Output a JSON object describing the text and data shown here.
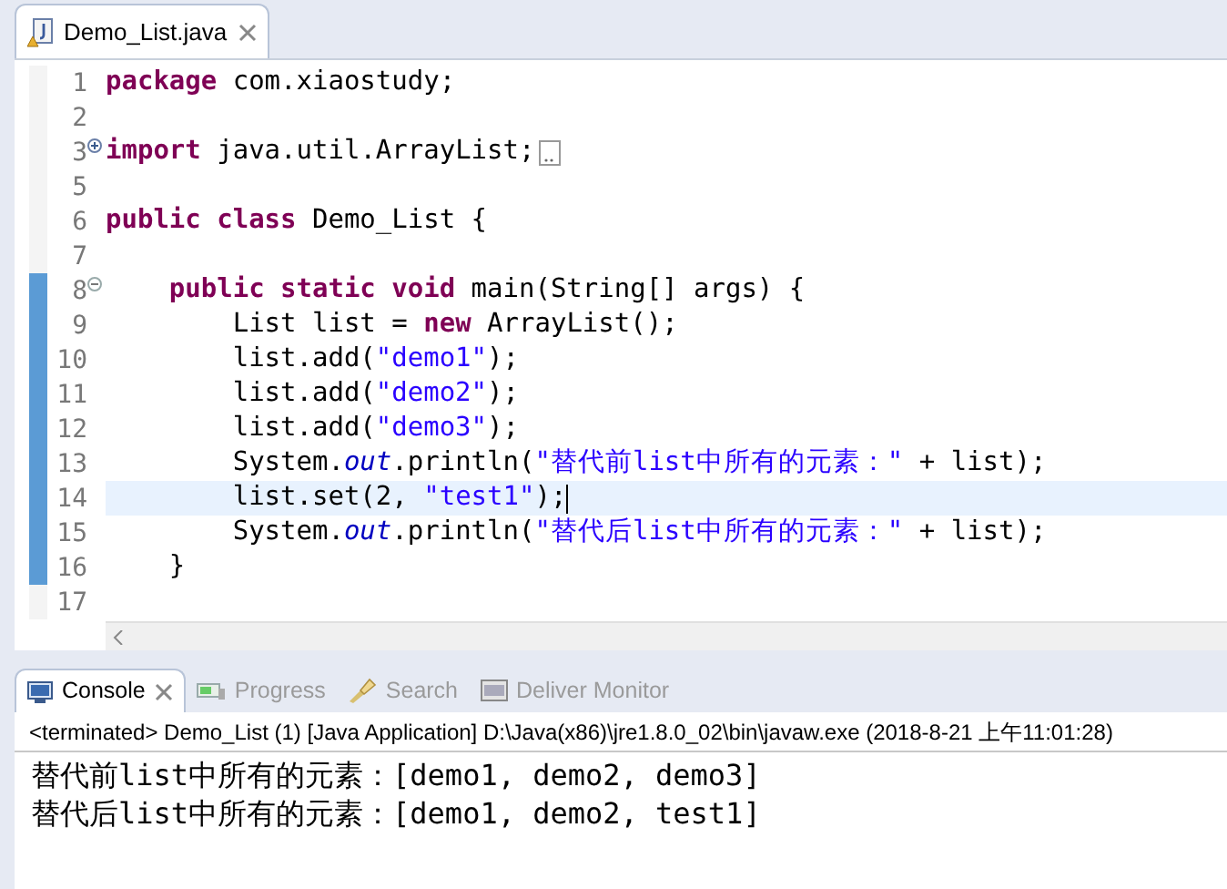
{
  "editor_tab": {
    "title": "Demo_List.java",
    "selected": true
  },
  "code_lines": [
    {
      "number": "1",
      "foldable": false,
      "changed": false,
      "current": false,
      "tokens": [
        {
          "kind": "keyword",
          "text": "package"
        },
        {
          "kind": "plain",
          "text": " com.xiaostudy;"
        }
      ]
    },
    {
      "number": "2",
      "foldable": false,
      "changed": false,
      "current": false
    },
    {
      "number": "3",
      "foldable": true,
      "folded": true,
      "changed": false,
      "current": false,
      "tokens": [
        {
          "kind": "keyword",
          "text": "import"
        },
        {
          "kind": "plain",
          "text": " java.util.ArrayList;"
        }
      ]
    },
    {
      "number": "5",
      "foldable": false,
      "changed": false,
      "current": false
    },
    {
      "number": "6",
      "foldable": false,
      "changed": false,
      "current": false,
      "tokens": [
        {
          "kind": "keyword",
          "text": "public class"
        },
        {
          "kind": "plain",
          "text": " Demo_List {"
        }
      ]
    },
    {
      "number": "7",
      "foldable": false,
      "changed": false,
      "current": false
    },
    {
      "number": "8",
      "foldable": true,
      "folded": false,
      "changed": true,
      "current": false,
      "tokens": [
        {
          "kind": "keyword",
          "text": "    public static void"
        },
        {
          "kind": "plain",
          "text": " main(String[] args) {"
        }
      ]
    },
    {
      "number": "9",
      "foldable": false,
      "changed": true,
      "current": false,
      "tokens": [
        {
          "kind": "plain",
          "text": "        List list = "
        },
        {
          "kind": "keyword",
          "text": "new"
        },
        {
          "kind": "plain",
          "text": " ArrayList();"
        }
      ]
    },
    {
      "number": "10",
      "foldable": false,
      "changed": true,
      "current": false,
      "tokens": [
        {
          "kind": "plain",
          "text": "        list.add("
        },
        {
          "kind": "string",
          "text": "\"demo1\""
        },
        {
          "kind": "plain",
          "text": ");"
        }
      ]
    },
    {
      "number": "11",
      "foldable": false,
      "changed": true,
      "current": false,
      "tokens": [
        {
          "kind": "plain",
          "text": "        list.add("
        },
        {
          "kind": "string",
          "text": "\"demo2\""
        },
        {
          "kind": "plain",
          "text": ");"
        }
      ]
    },
    {
      "number": "12",
      "foldable": false,
      "changed": true,
      "current": false,
      "tokens": [
        {
          "kind": "plain",
          "text": "        list.add("
        },
        {
          "kind": "string",
          "text": "\"demo3\""
        },
        {
          "kind": "plain",
          "text": ");"
        }
      ]
    },
    {
      "number": "13",
      "foldable": false,
      "changed": true,
      "current": false,
      "tokens": [
        {
          "kind": "plain",
          "text": "        System."
        },
        {
          "kind": "field",
          "text": "out"
        },
        {
          "kind": "plain",
          "text": ".println("
        },
        {
          "kind": "string",
          "text": "\"替代前list中所有的元素：\""
        },
        {
          "kind": "plain",
          "text": " + list);"
        }
      ]
    },
    {
      "number": "14",
      "foldable": false,
      "changed": true,
      "current": true,
      "tokens": [
        {
          "kind": "plain",
          "text": "        list.set(2, "
        },
        {
          "kind": "string",
          "text": "\"test1\""
        },
        {
          "kind": "plain",
          "text": ");"
        }
      ]
    },
    {
      "number": "15",
      "foldable": false,
      "changed": true,
      "current": false,
      "tokens": [
        {
          "kind": "plain",
          "text": "        System."
        },
        {
          "kind": "field",
          "text": "out"
        },
        {
          "kind": "plain",
          "text": ".println("
        },
        {
          "kind": "string",
          "text": "\"替代后list中所有的元素：\""
        },
        {
          "kind": "plain",
          "text": " + list);"
        }
      ]
    },
    {
      "number": "16",
      "foldable": false,
      "changed": true,
      "current": false,
      "tokens": [
        {
          "kind": "plain",
          "text": "    }"
        }
      ]
    },
    {
      "number": "17",
      "foldable": false,
      "changed": false,
      "current": false
    }
  ],
  "console_tabs": [
    {
      "kind": "console",
      "label": "Console",
      "selected": true
    },
    {
      "kind": "progress",
      "label": "Progress",
      "selected": false
    },
    {
      "kind": "search",
      "label": "Search",
      "selected": false
    },
    {
      "kind": "monitor",
      "label": "Deliver Monitor",
      "selected": false
    }
  ],
  "console_header": "<terminated> Demo_List (1) [Java Application] D:\\Java(x86)\\jre1.8.0_02\\bin\\javaw.exe (2018-8-21 上午11:01:28)",
  "console_output": [
    "替代前list中所有的元素：[demo1, demo2, demo3]",
    "替代后list中所有的元素：[demo1, demo2, test1]"
  ]
}
